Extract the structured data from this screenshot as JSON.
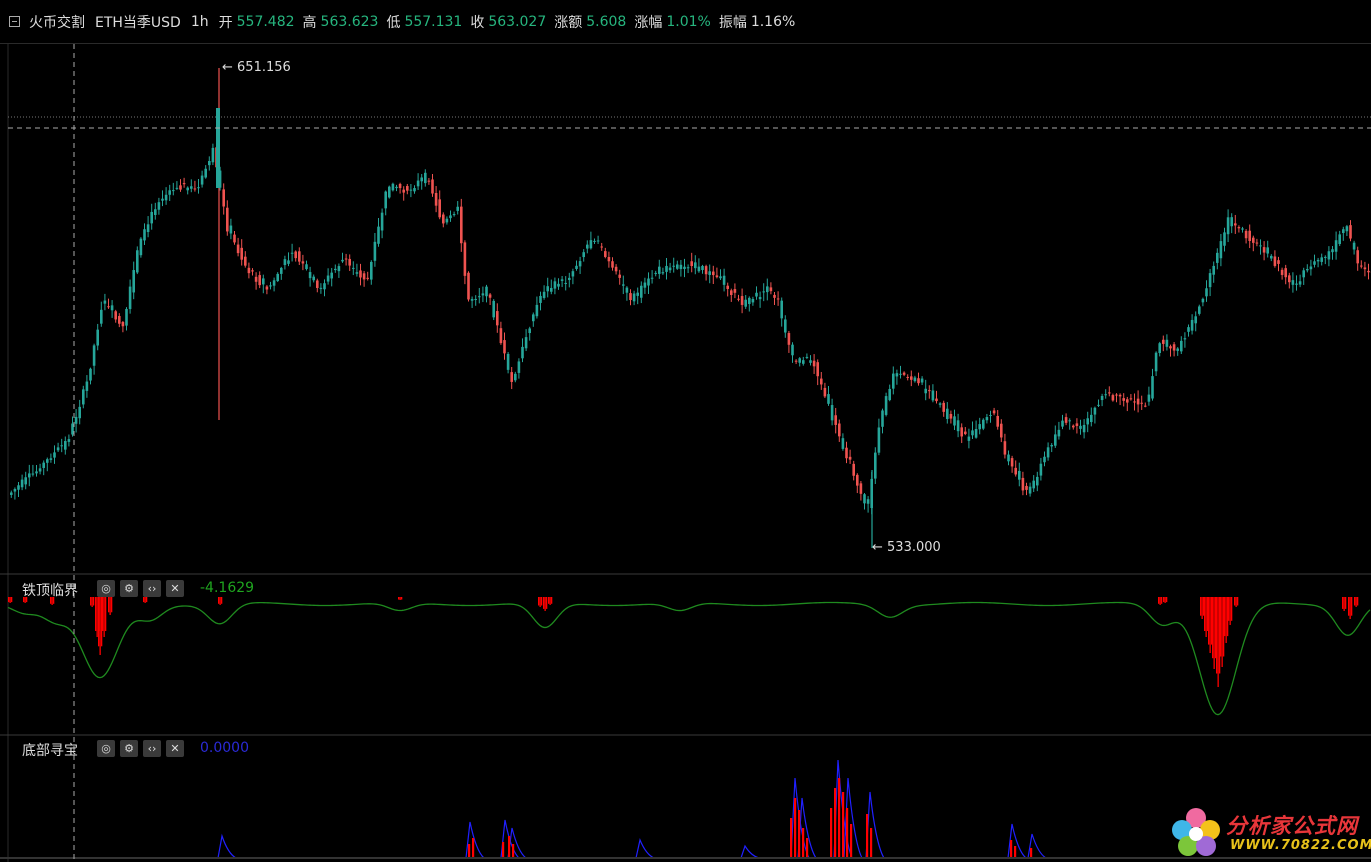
{
  "header": {
    "exchange": "火币交割",
    "symbol": "ETH当季USD",
    "interval": "1h",
    "open_label": "开",
    "open_value": "557.482",
    "high_label": "高",
    "high_value": "563.623",
    "low_label": "低",
    "low_value": "557.131",
    "close_label": "收",
    "close_value": "563.027",
    "change_label": "涨额",
    "change_value": "5.608",
    "pct_label": "涨幅",
    "pct_value": "1.01%",
    "amp_label": "振幅",
    "amp_value": "1.16%"
  },
  "main_chart": {
    "max_marker": "651.156",
    "min_marker": "533.000"
  },
  "panels": [
    {
      "title": "铁顶临界",
      "value": "-4.1629",
      "value_color": "#1fa51f"
    },
    {
      "title": "底部寻宝",
      "value": "0.0000",
      "value_color": "#2a2ad6"
    }
  ],
  "icons": {
    "hide": "eye-off-icon",
    "settings": "gear-icon",
    "code": "code-icon",
    "close": "close-icon"
  },
  "colors": {
    "up": "#26a69a",
    "down": "#ef5350",
    "indicator_line": "#1f8a1f",
    "indicator_bar": "#ff0000",
    "bottom_line": "#2020ff"
  },
  "watermark": {
    "brand": "分析家公式网",
    "url": "WWW.70822.COM"
  }
}
